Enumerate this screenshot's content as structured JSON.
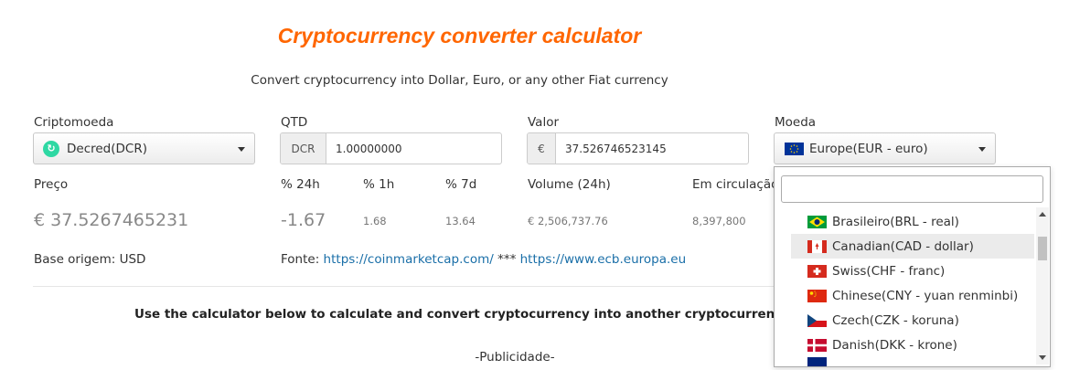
{
  "header": {
    "title": "Cryptocurrency converter calculator",
    "subtitle": "Convert cryptocurrency into Dollar, Euro, or any other Fiat currency"
  },
  "form": {
    "crypto_label": "Criptomoeda",
    "crypto_value": "Decred(DCR)",
    "qtd_label": "QTD",
    "qtd_addon": "DCR",
    "qtd_value": "1.00000000",
    "valor_label": "Valor",
    "valor_addon": "€",
    "valor_value": "37.526746523145",
    "moeda_label": "Moeda",
    "moeda_value": "Europe(EUR - euro)"
  },
  "stats": {
    "preco_label": "Preço",
    "preco_value": "€ 37.5267465231",
    "ch24_label": "% 24h",
    "ch24_value": "-1.67",
    "ch1_label": "% 1h",
    "ch1_value": "1.68",
    "ch7_label": "% 7d",
    "ch7_value": "13.64",
    "volume_label": "Volume (24h)",
    "volume_value": "€ 2,506,737.76",
    "circ_label": "Em circulação",
    "circ_value": "8,397,800"
  },
  "footer": {
    "base_text": "Base origem: USD",
    "fonte_label": "Fonte:",
    "link1": "https://coinmarketcap.com/",
    "separator": "***",
    "link2": "https://www.ecb.europa.eu",
    "calc_text": "Use the calculator below to calculate and convert cryptocurrency into another cryptocurrency",
    "ad_text": "-Publicidade-"
  },
  "dropdown": {
    "search_value": "",
    "items": [
      {
        "label": "Brasileiro(BRL - real)",
        "flag": "br-flag-icon"
      },
      {
        "label": "Canadian(CAD - dollar)",
        "flag": "ca-flag-icon"
      },
      {
        "label": "Swiss(CHF - franc)",
        "flag": "ch-flag-icon"
      },
      {
        "label": "Chinese(CNY - yuan renminbi)",
        "flag": "cn-flag-icon"
      },
      {
        "label": "Czech(CZK - koruna)",
        "flag": "cz-flag-icon"
      },
      {
        "label": "Danish(DKK - krone)",
        "flag": "dk-flag-icon"
      }
    ],
    "highlighted_index": 1
  },
  "colors": {
    "title": "#ff6600",
    "link": "#1a6fa8",
    "decred": "#2ed8a3"
  }
}
